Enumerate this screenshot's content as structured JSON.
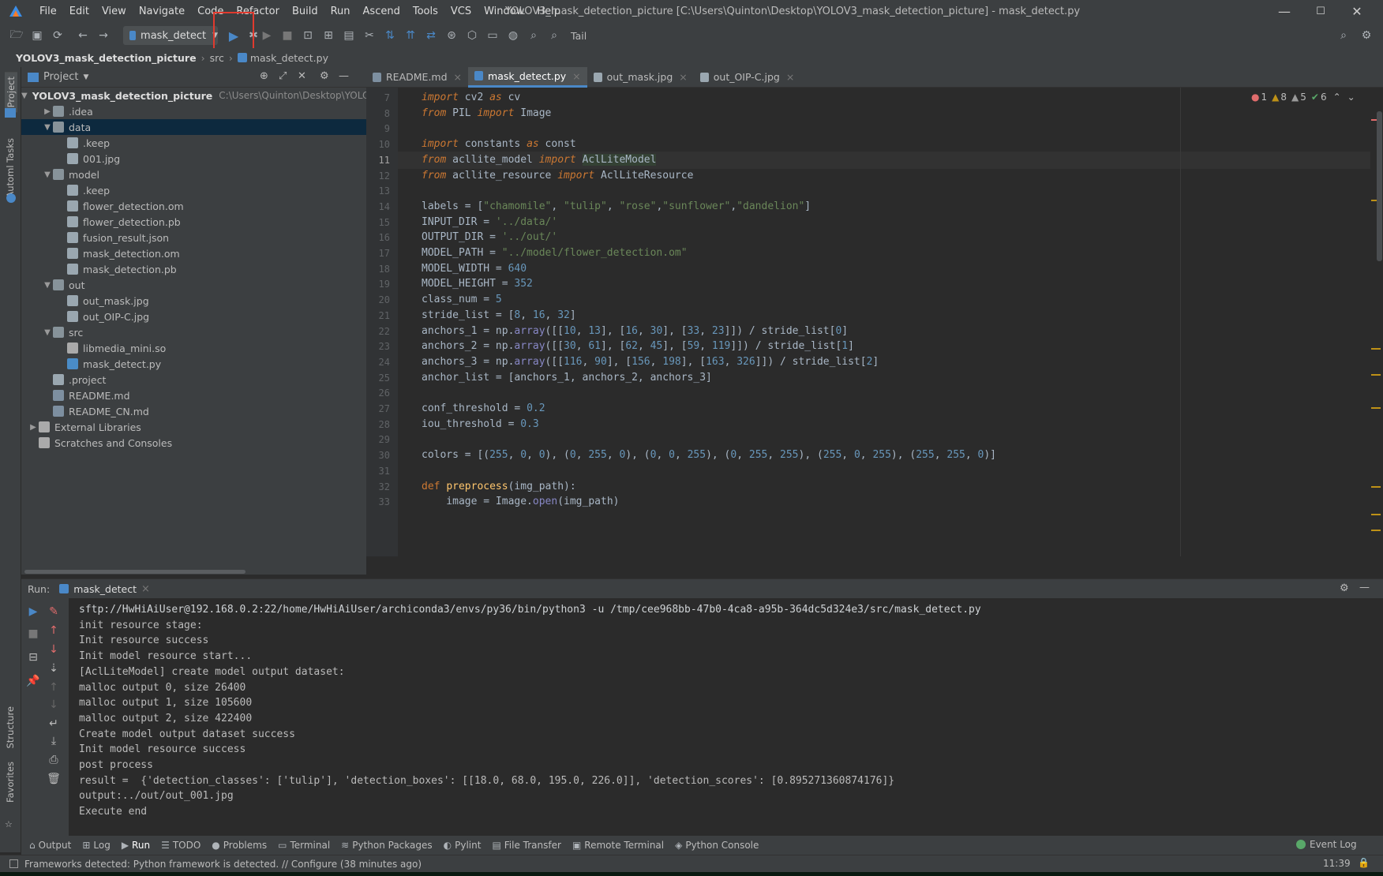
{
  "menu": [
    "File",
    "Edit",
    "View",
    "Navigate",
    "Code",
    "Refactor",
    "Build",
    "Run",
    "Ascend",
    "Tools",
    "VCS",
    "Window",
    "Help"
  ],
  "window_title": "YOLOV3_mask_detection_picture [C:\\Users\\Quinton\\Desktop\\YOLOV3_mask_detection_picture] - mask_detect.py",
  "window_controls": {
    "minimize": "—",
    "maximize": "☐",
    "close": "✕"
  },
  "toolbar": {
    "run_config": "mask_detect",
    "tail_label": "Tail"
  },
  "breadcrumb": [
    "YOLOV3_mask_detection_picture",
    "src",
    "mask_detect.py"
  ],
  "left_stripe": {
    "project": "Project",
    "automl": "Automl Tasks",
    "structure": "Structure",
    "favorites": "Favorites"
  },
  "project_panel": {
    "title": "Project",
    "root_path": "C:\\Users\\Quinton\\Desktop\\YOLOV3_mask_detection_picture",
    "tree": [
      {
        "label": "YOLOV3_mask_detection_picture",
        "type": "root",
        "depth": 0,
        "open": true
      },
      {
        "label": ".idea",
        "type": "folder",
        "depth": 1,
        "open": false
      },
      {
        "label": "data",
        "type": "folder",
        "depth": 1,
        "open": true,
        "selected": true
      },
      {
        "label": ".keep",
        "type": "file",
        "depth": 2
      },
      {
        "label": "001.jpg",
        "type": "file",
        "depth": 2
      },
      {
        "label": "model",
        "type": "folder",
        "depth": 1,
        "open": true
      },
      {
        "label": ".keep",
        "type": "file",
        "depth": 2
      },
      {
        "label": "flower_detection.om",
        "type": "file",
        "depth": 2
      },
      {
        "label": "flower_detection.pb",
        "type": "file",
        "depth": 2
      },
      {
        "label": "fusion_result.json",
        "type": "file",
        "depth": 2
      },
      {
        "label": "mask_detection.om",
        "type": "file",
        "depth": 2
      },
      {
        "label": "mask_detection.pb",
        "type": "file",
        "depth": 2
      },
      {
        "label": "out",
        "type": "folder",
        "depth": 1,
        "open": true
      },
      {
        "label": "out_mask.jpg",
        "type": "file",
        "depth": 2
      },
      {
        "label": "out_OIP-C.jpg",
        "type": "file",
        "depth": 2
      },
      {
        "label": "src",
        "type": "folder",
        "depth": 1,
        "open": true
      },
      {
        "label": "libmedia_mini.so",
        "type": "lib",
        "depth": 2
      },
      {
        "label": "mask_detect.py",
        "type": "py",
        "depth": 2
      },
      {
        "label": ".project",
        "type": "file",
        "depth": 1
      },
      {
        "label": "README.md",
        "type": "md",
        "depth": 1
      },
      {
        "label": "README_CN.md",
        "type": "md",
        "depth": 1
      },
      {
        "label": "External Libraries",
        "type": "lib",
        "depth": 0,
        "open": false
      },
      {
        "label": "Scratches and Consoles",
        "type": "scratch",
        "depth": 0
      }
    ]
  },
  "editor": {
    "tabs": [
      {
        "label": "README.md",
        "active": false
      },
      {
        "label": "mask_detect.py",
        "active": true
      },
      {
        "label": "out_mask.jpg",
        "active": false
      },
      {
        "label": "out_OIP-C.jpg",
        "active": false
      }
    ],
    "inspections": {
      "errors": "1",
      "warnings": "8",
      "weak": "5",
      "ok": "6"
    },
    "current_line": 11,
    "lines": [
      {
        "n": "7",
        "html": "<span class=\"kw\">import</span> cv2 <span class=\"kw\">as</span> cv"
      },
      {
        "n": "8",
        "html": "<span class=\"kw\">from</span> PIL <span class=\"kw\">import</span> Image"
      },
      {
        "n": "9",
        "html": ""
      },
      {
        "n": "10",
        "html": "<span class=\"kw\">import</span> constants <span class=\"kw\">as</span> const"
      },
      {
        "n": "11",
        "html": "<span class=\"kw\">from</span> acllite_model <span class=\"kw\">import</span> <span class=\"hl\">AclLiteModel</span>"
      },
      {
        "n": "12",
        "html": "<span class=\"kw\">from</span> acllite_resource <span class=\"kw\">import</span> AclLiteResource"
      },
      {
        "n": "13",
        "html": ""
      },
      {
        "n": "14",
        "html": "labels = [<span class=\"str\">\"chamomile\"</span>, <span class=\"str\">\"tulip\"</span>, <span class=\"str\">\"rose\"</span>,<span class=\"str\">\"sunflower\"</span>,<span class=\"str\">\"dandelion\"</span>]"
      },
      {
        "n": "15",
        "html": "INPUT_DIR = <span class=\"str\">'../data/'</span>"
      },
      {
        "n": "16",
        "html": "OUTPUT_DIR = <span class=\"str\">'../out/'</span>"
      },
      {
        "n": "17",
        "html": "MODEL_PATH = <span class=\"str\">\"../model/flower_detection.om\"</span>"
      },
      {
        "n": "18",
        "html": "MODEL_WIDTH = <span class=\"num\">640</span>"
      },
      {
        "n": "19",
        "html": "MODEL_HEIGHT = <span class=\"num\">352</span>"
      },
      {
        "n": "20",
        "html": "class_num = <span class=\"num\">5</span>"
      },
      {
        "n": "21",
        "html": "stride_list = [<span class=\"num\">8</span>, <span class=\"num\">16</span>, <span class=\"num\">32</span>]"
      },
      {
        "n": "22",
        "html": "anchors_1 = np.<span class=\"builtin\">array</span>([[<span class=\"num\">10</span>, <span class=\"num\">13</span>], [<span class=\"num\">16</span>, <span class=\"num\">30</span>], [<span class=\"num\">33</span>, <span class=\"num\">23</span>]]) / stride_list[<span class=\"num\">0</span>]"
      },
      {
        "n": "23",
        "html": "anchors_2 = np.<span class=\"builtin\">array</span>([[<span class=\"num\">30</span>, <span class=\"num\">61</span>], [<span class=\"num\">62</span>, <span class=\"num\">45</span>], [<span class=\"num\">59</span>, <span class=\"num\">119</span>]]) / stride_list[<span class=\"num\">1</span>]"
      },
      {
        "n": "24",
        "html": "anchors_3 = np.<span class=\"builtin\">array</span>([[<span class=\"num\">116</span>, <span class=\"num\">90</span>], [<span class=\"num\">156</span>, <span class=\"num\">198</span>], [<span class=\"num\">163</span>, <span class=\"num\">326</span>]]) / stride_list[<span class=\"num\">2</span>]"
      },
      {
        "n": "25",
        "html": "anchor_list = [anchors_1, anchors_2, anchors_3]"
      },
      {
        "n": "26",
        "html": ""
      },
      {
        "n": "27",
        "html": "conf_threshold = <span class=\"num\">0.2</span>"
      },
      {
        "n": "28",
        "html": "iou_threshold = <span class=\"num\">0.3</span>"
      },
      {
        "n": "29",
        "html": ""
      },
      {
        "n": "30",
        "html": "colors = [(<span class=\"num\">255</span>, <span class=\"num\">0</span>, <span class=\"num\">0</span>), (<span class=\"num\">0</span>, <span class=\"num\">255</span>, <span class=\"num\">0</span>), (<span class=\"num\">0</span>, <span class=\"num\">0</span>, <span class=\"num\">255</span>), (<span class=\"num\">0</span>, <span class=\"num\">255</span>, <span class=\"num\">255</span>), (<span class=\"num\">255</span>, <span class=\"num\">0</span>, <span class=\"num\">255</span>), (<span class=\"num\">255</span>, <span class=\"num\">255</span>, <span class=\"num\">0</span>)]"
      },
      {
        "n": "31",
        "html": ""
      },
      {
        "n": "32",
        "html": "<span class=\"kwn\">def</span> <span class=\"fn\">preprocess</span>(img_path):"
      },
      {
        "n": "33",
        "html": "    image = Image.<span class=\"builtin\">open</span>(img_path)"
      }
    ]
  },
  "run_panel": {
    "label": "Run:",
    "tab": "mask_detect",
    "output": [
      "sftp://HwHiAiUser@192.168.0.2:22/home/HwHiAiUser/archiconda3/envs/py36/bin/python3 -u /tmp/cee968bb-47b0-4ca8-a95b-364dc5d324e3/src/mask_detect.py",
      "init resource stage:",
      "Init resource success",
      "Init model resource start...",
      "[AclLiteModel] create model output dataset:",
      "malloc output 0, size 26400",
      "malloc output 1, size 105600",
      "malloc output 2, size 422400",
      "Create model output dataset success",
      "Init model resource success",
      "post process",
      "result =  {'detection_classes': ['tulip'], 'detection_boxes': [[18.0, 68.0, 195.0, 226.0]], 'detection_scores': [0.895271360874176]}",
      "output:../out/out_001.jpg",
      "Execute end"
    ]
  },
  "bottom_tools": [
    "Output",
    "Log",
    "Run",
    "TODO",
    "Problems",
    "Terminal",
    "Python Packages",
    "Pylint",
    "File Transfer",
    "Remote Terminal",
    "Python Console"
  ],
  "event_log": "Event Log",
  "status": {
    "message": "Frameworks detected: Python framework is detected. // Configure (38 minutes ago)",
    "time": "11:39"
  },
  "colors": {
    "accent": "#4a88c7",
    "highlight_box": "#e03a2e",
    "error": "#e06c6c",
    "warning": "#be9117",
    "ok": "#59a869"
  }
}
